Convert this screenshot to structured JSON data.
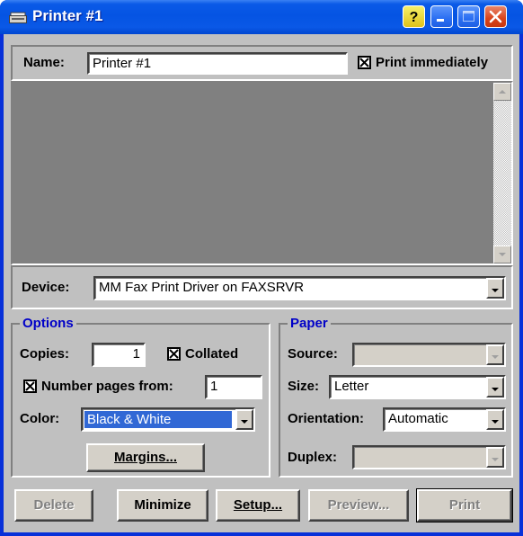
{
  "window": {
    "title": "Printer #1"
  },
  "name_row": {
    "label": "Name:",
    "value": "Printer #1",
    "print_immediately_label": "Print immediately",
    "print_immediately_checked": true
  },
  "device": {
    "label": "Device:",
    "value": "MM Fax Print Driver on FAXSRVR"
  },
  "options": {
    "title": "Options",
    "copies_label": "Copies:",
    "copies_value": "1",
    "collated_label": "Collated",
    "collated_checked": true,
    "number_pages_label": "Number pages from:",
    "number_pages_checked": true,
    "number_pages_value": "1",
    "color_label": "Color:",
    "color_value": "Black & White",
    "margins_button": "Margins..."
  },
  "paper": {
    "title": "Paper",
    "source_label": "Source:",
    "source_value": "",
    "size_label": "Size:",
    "size_value": "Letter",
    "orientation_label": "Orientation:",
    "orientation_value": "Automatic",
    "duplex_label": "Duplex:",
    "duplex_value": ""
  },
  "buttons": {
    "delete": "Delete",
    "minimize": "Minimize",
    "setup": "Setup...",
    "preview": "Preview...",
    "print": "Print"
  },
  "colors": {
    "title_bar": "#0a5ae7",
    "dialog_face": "#c0c0c0",
    "group_title": "#0000c8",
    "selection": "#3168d5"
  }
}
